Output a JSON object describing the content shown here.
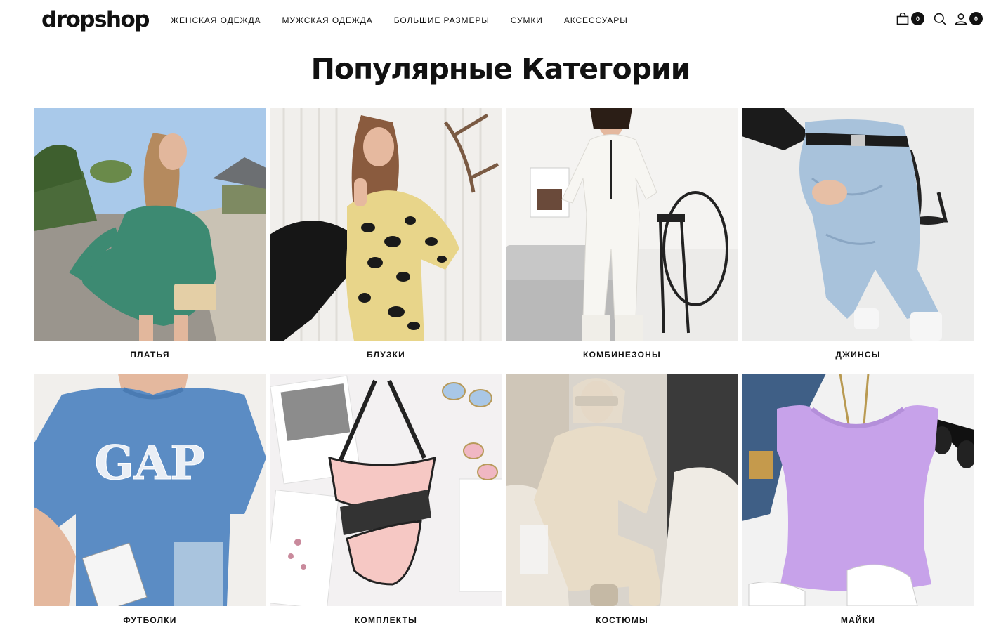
{
  "brand": {
    "logo": "dropshop"
  },
  "nav": {
    "items": [
      {
        "label": "ЖЕНСКАЯ ОДЕЖДА"
      },
      {
        "label": "МУЖСКАЯ ОДЕЖДА"
      },
      {
        "label": "БОЛЬШИЕ РАЗМЕРЫ"
      },
      {
        "label": "СУМКИ"
      },
      {
        "label": "АКСЕССУАРЫ"
      }
    ]
  },
  "tools": {
    "cart_icon": "shopping-bag-icon",
    "cart_count": "0",
    "search_icon": "search-icon",
    "account_icon": "user-icon",
    "account_count": "0"
  },
  "section": {
    "title": "Популярные Категории"
  },
  "categories": [
    {
      "label": "ПЛАТЬЯ",
      "image": "woman in green polka-dot dress on sunny street with palm trees"
    },
    {
      "label": "БЛУЗКИ",
      "image": "woman in leopard print blouse sitting against white wall"
    },
    {
      "label": "КОМБИНЕЗОНЫ",
      "image": "woman in white zip jumpsuit in grey interior"
    },
    {
      "label": "ДЖИНСЫ",
      "image": "light wash high-waist mom jeans with black belt"
    },
    {
      "label": "ФУТБОЛКИ",
      "image": "blue oversized t-shirt with white GAP logo"
    },
    {
      "label": "КОМПЛЕКТЫ",
      "image": "pink sports bra and briefs set flat lay with sunglasses"
    },
    {
      "label": "КОСТЮМЫ",
      "image": "woman in beige hoodie tracksuit sitting in car"
    },
    {
      "label": "МАЙКИ",
      "image": "lilac ribbed tank top flat lay with denim and sneakers"
    }
  ],
  "colors": {
    "text": "#111111",
    "background": "#ffffff",
    "badge": "#111111"
  }
}
